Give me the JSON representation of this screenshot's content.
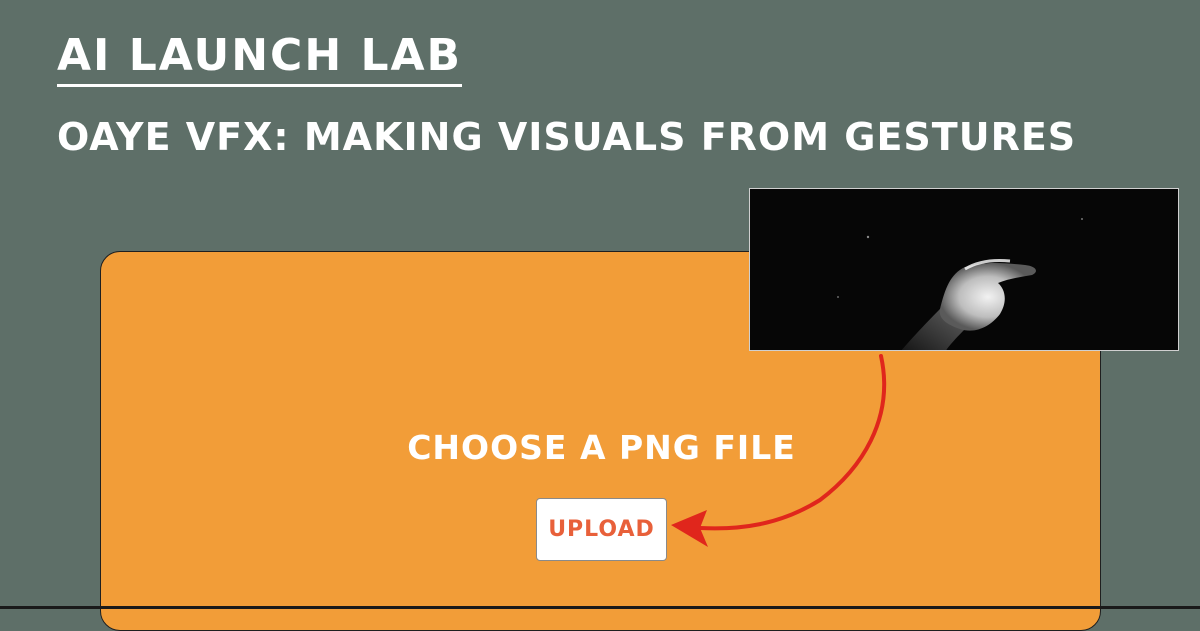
{
  "header": {
    "title": "AI LAUNCH LAB",
    "subtitle": "OAYE VFX: MAKING VISUALS FROM GESTURES"
  },
  "upload_card": {
    "prompt": "CHOOSE A PNG FILE",
    "button_label": "UPLOAD"
  },
  "colors": {
    "background": "#5e6f68",
    "card": "#f29d38",
    "button_text": "#e8603a",
    "arrow": "#e0261c"
  },
  "icons": {
    "preview": "hand-gesture-video",
    "annotation": "red-arrow"
  }
}
